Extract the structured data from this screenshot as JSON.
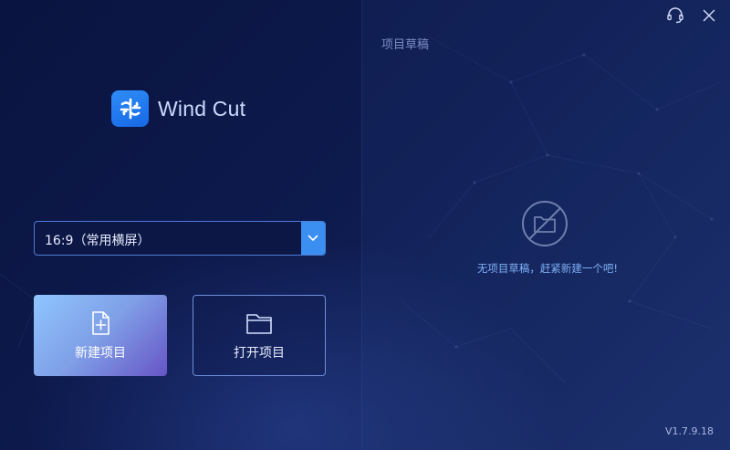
{
  "app": {
    "name": "Wind Cut",
    "version": "V1.7.9.18"
  },
  "window_controls": {
    "support_icon": "headset-icon",
    "close_icon": "close-icon"
  },
  "aspect_ratio": {
    "selected": "16:9（常用横屏）"
  },
  "actions": {
    "new_project": "新建项目",
    "open_project": "打开项目"
  },
  "drafts": {
    "title": "项目草稿",
    "empty_message": "无项目草稿，赶紧新建一个吧!"
  },
  "colors": {
    "accent": "#3a8ff0",
    "brand": "#1e78ee"
  }
}
